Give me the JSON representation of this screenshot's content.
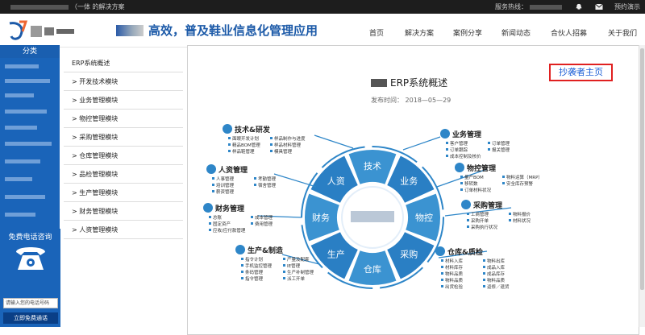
{
  "topbar": {
    "intro": "（一体    的解决方案",
    "hotline_label": "服务热线：",
    "demo_label": "预约演示"
  },
  "header": {
    "slogan": "高效，普及鞋业信息化管理应用",
    "nav": [
      "首页",
      "解决方案",
      "案例分享",
      "新闻动态",
      "合伙人招募",
      "关于我们"
    ]
  },
  "sidebar": {
    "title": "分类",
    "menu": [
      "ERP系统概述",
      "开发技术模块",
      "业务管理模块",
      "物控管理模块",
      "采购管理模块",
      "仓库管理模块",
      "品检管理模块",
      "生产管理模块",
      "财务管理模块",
      "人资管理模块"
    ]
  },
  "article": {
    "title": "ERP系统概述",
    "date_label": "发布时间：",
    "date": "2018—05—29",
    "watermark": "抄袭者主页"
  },
  "diagram": {
    "ring_labels": [
      "技术",
      "业务",
      "物控",
      "采购",
      "仓库",
      "生产",
      "财务",
      "人资"
    ],
    "modules": [
      {
        "title": "技术&研发",
        "items": [
          "面眼开发计划",
          "样品制作与进度",
          "精品BOM管理",
          "样品材料管理",
          "样品鞋管理",
          "模具管理"
        ]
      },
      {
        "title": "人资管理",
        "items": [
          "人事管理",
          "考勤管理",
          "培训管理",
          "宿舍管理",
          "薪资管理"
        ]
      },
      {
        "title": "财务管理",
        "items": [
          "总账",
          "成本管理",
          "固定资产",
          "费用管理",
          "应收/应付款管理"
        ]
      },
      {
        "title": "生产&制造",
        "items": [
          "指令计划",
          "产量及配套",
          "手机监控管理",
          "IE管理",
          "条码管理",
          "生产补制管理",
          "指令管理",
          "派工开单"
        ]
      },
      {
        "title": "业务管理",
        "items": [
          "客户管理",
          "订单管理",
          "订单跟踪",
          "报关管理",
          "成本控制及核价"
        ]
      },
      {
        "title": "物控管理",
        "items": [
          "量产BOM",
          "物料运算（MRP）",
          "移转数",
          "安全库存预警",
          "订单材料状况"
        ]
      },
      {
        "title": "采购管理",
        "items": [
          "工商管理",
          "物料报价",
          "采购开单",
          "材料状况",
          "采购执行状况"
        ]
      },
      {
        "title": "仓库&质检",
        "items": [
          "材料入库",
          "物料出库",
          "材料库存",
          "成品入库",
          "物料品质",
          "成品库存",
          "物料品质",
          "物料品质",
          "出货检验",
          "返修／退货"
        ]
      }
    ]
  },
  "phone_panel": {
    "title": "免费电话咨询",
    "placeholder": "请输入您的电话号码",
    "button": "立即免费通话"
  },
  "colors": {
    "brand_blue": "#1a64b9",
    "diagram_blue": "#2e86c8",
    "watermark_border": "#e02020"
  }
}
